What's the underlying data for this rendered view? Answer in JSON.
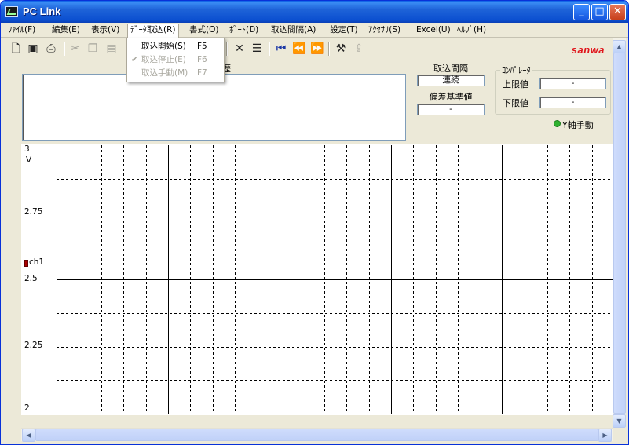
{
  "window": {
    "title": "PC Link",
    "minimize_icon": "minimize-icon",
    "maximize_icon": "maximize-icon",
    "close_icon": "close-icon"
  },
  "menu": [
    {
      "label": "ﾌｧｲﾙ(F)"
    },
    {
      "label": "編集(E)"
    },
    {
      "label": "表示(V)"
    },
    {
      "label": "ﾃﾞｰﾀ取込(R)"
    },
    {
      "label": "書式(O)"
    },
    {
      "label": "ﾎﾟｰﾄ(D)"
    },
    {
      "label": "取込間隔(A)"
    },
    {
      "label": "設定(T)"
    },
    {
      "label": "ｱｸｾｻﾘ(S)"
    },
    {
      "label": "Excel(U)"
    },
    {
      "label": "ﾍﾙﾌﾟ(H)"
    }
  ],
  "dropdown": {
    "items": [
      {
        "label": "取込開始(S)",
        "shortcut": "F5",
        "enabled": true
      },
      {
        "label": "取込停止(E)",
        "shortcut": "F6",
        "enabled": false,
        "checked": true
      },
      {
        "label": "取込手動(M)",
        "shortcut": "F7",
        "enabled": false
      }
    ]
  },
  "toolbar": {
    "brand": "sanwa",
    "buttons": [
      "new-file-icon",
      "save-icon",
      "print-icon",
      "cut-icon",
      "copy-icon",
      "paste-icon",
      "delete-icon",
      "list-icon",
      "jump-start-icon",
      "rewind-icon",
      "forward-icon",
      "tools-icon",
      "help-pointer-icon"
    ]
  },
  "memo": {
    "label_fragment": "歴",
    "value": ""
  },
  "interval": {
    "label": "取込間隔",
    "value": "連続"
  },
  "deviation": {
    "label": "偏差基準値",
    "value": "-"
  },
  "comparator": {
    "title": "ｺﾝﾊﾟﾚｰﾀ",
    "upper_label": "上限値",
    "upper_value": "-",
    "lower_label": "下限値",
    "lower_value": "-"
  },
  "y_manual": {
    "label": "Y軸手動",
    "color": "#2fb12f"
  },
  "chart_data": {
    "type": "line",
    "ylim": [
      2,
      3
    ],
    "yticks": [
      "3",
      "2.75",
      "2.5",
      "2.25",
      "2"
    ],
    "yunit": "V",
    "series": [
      {
        "name": "ch1",
        "color": "#aa0000",
        "values": []
      }
    ],
    "grid": true
  }
}
